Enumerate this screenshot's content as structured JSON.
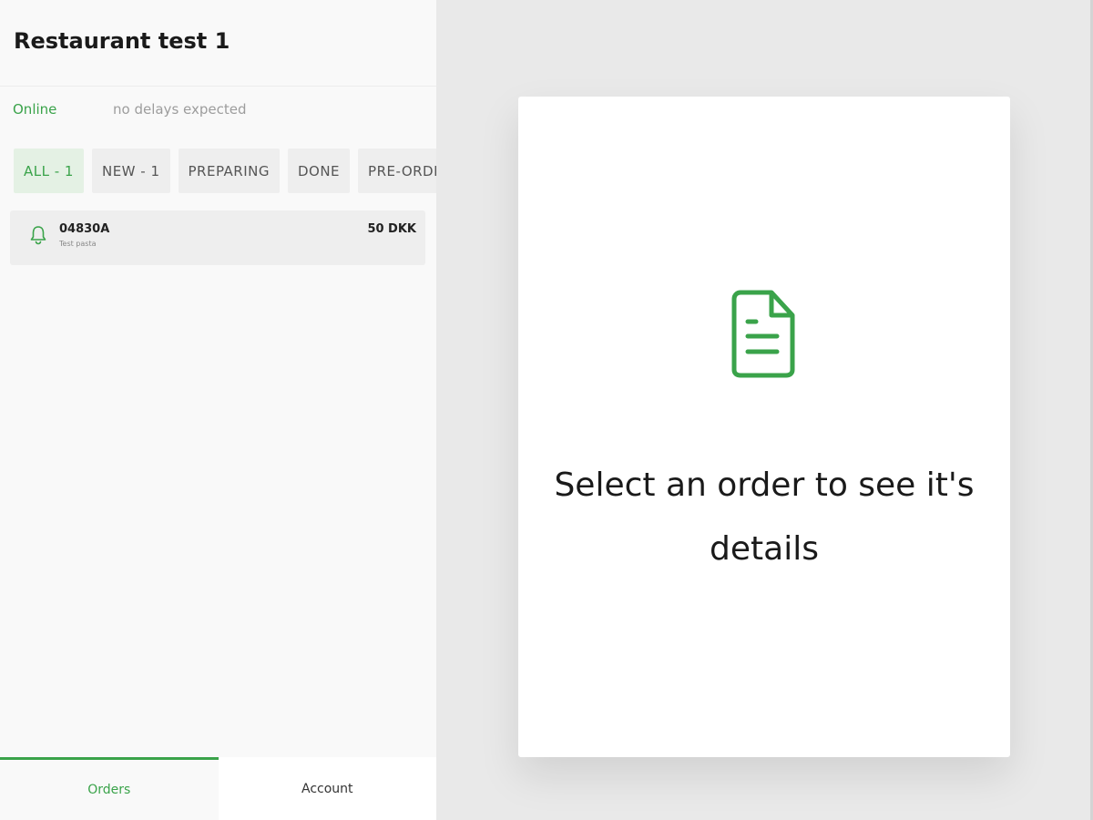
{
  "restaurant": {
    "title": "Restaurant test 1",
    "status": "Online",
    "delay_text": "no delays expected"
  },
  "tabs": [
    {
      "label": "ALL - 1",
      "active": true
    },
    {
      "label": "NEW - 1",
      "active": false
    },
    {
      "label": "PREPARING",
      "active": false
    },
    {
      "label": "DONE",
      "active": false
    },
    {
      "label": "PRE-ORDE",
      "active": false
    }
  ],
  "orders": [
    {
      "id": "04830A",
      "subtitle": "Test pasta",
      "price": "50 DKK",
      "icon": "bell-icon"
    }
  ],
  "bottom_nav": {
    "orders_label": "Orders",
    "account_label": "Account"
  },
  "detail": {
    "icon": "document-icon",
    "message": "Select an order to see it's details"
  },
  "colors": {
    "accent": "#3aa34a",
    "panel_bg": "#f9f9f9",
    "page_bg": "#e9e9e9"
  }
}
